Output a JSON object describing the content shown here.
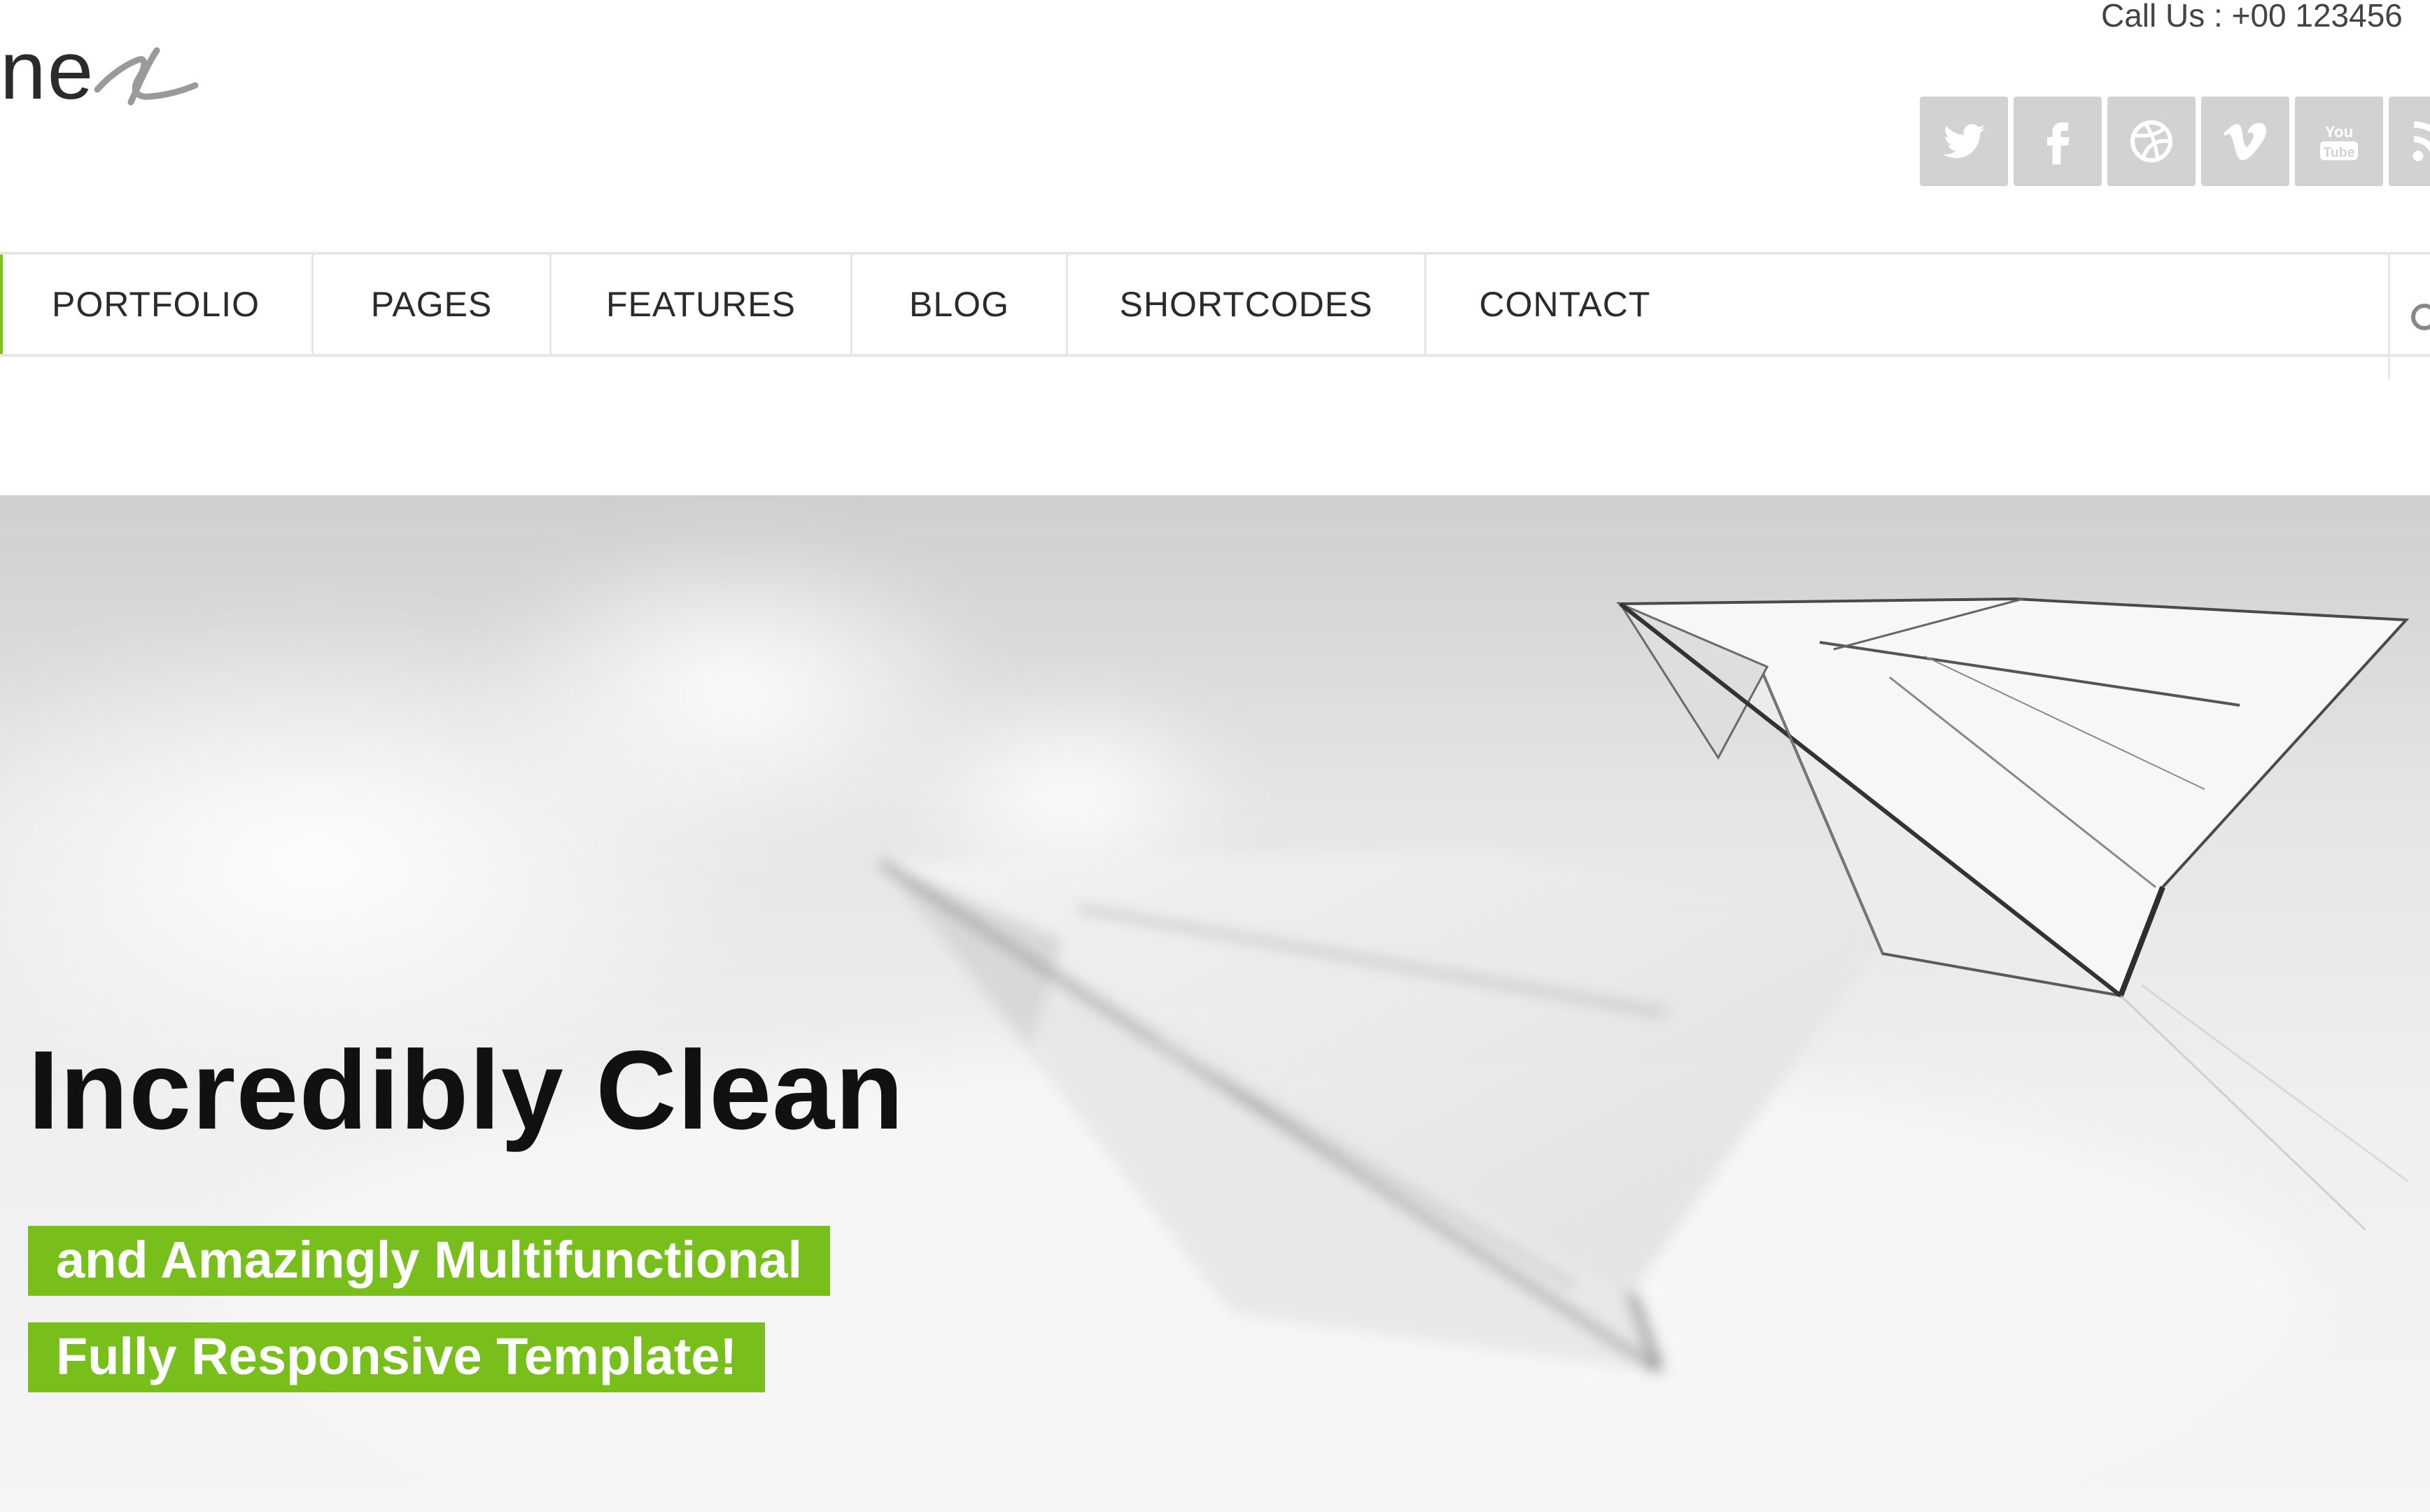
{
  "header": {
    "logo_text": "ne",
    "call_us": "Call Us : +00 123456"
  },
  "social": [
    {
      "name": "twitter-icon",
      "label": "Twitter"
    },
    {
      "name": "facebook-icon",
      "label": "Facebook"
    },
    {
      "name": "dribbble-icon",
      "label": "Dribbble"
    },
    {
      "name": "vimeo-icon",
      "label": "Vimeo"
    },
    {
      "name": "youtube-icon",
      "label": "YouTube"
    },
    {
      "name": "rss-icon",
      "label": "RSS"
    }
  ],
  "nav": {
    "items": [
      {
        "label": "PORTFOLIO"
      },
      {
        "label": "PAGES"
      },
      {
        "label": "FEATURES"
      },
      {
        "label": "BLOG"
      },
      {
        "label": "SHORTCODES"
      },
      {
        "label": "CONTACT"
      }
    ]
  },
  "hero": {
    "title": "Incredibly Clean",
    "tagline_1": "and Amazingly Multifunctional",
    "tagline_2": "Fully Responsive Template!"
  },
  "colors": {
    "accent": "#7dc21e",
    "social_bg": "#d2d2d2",
    "text_dark": "#111111"
  }
}
